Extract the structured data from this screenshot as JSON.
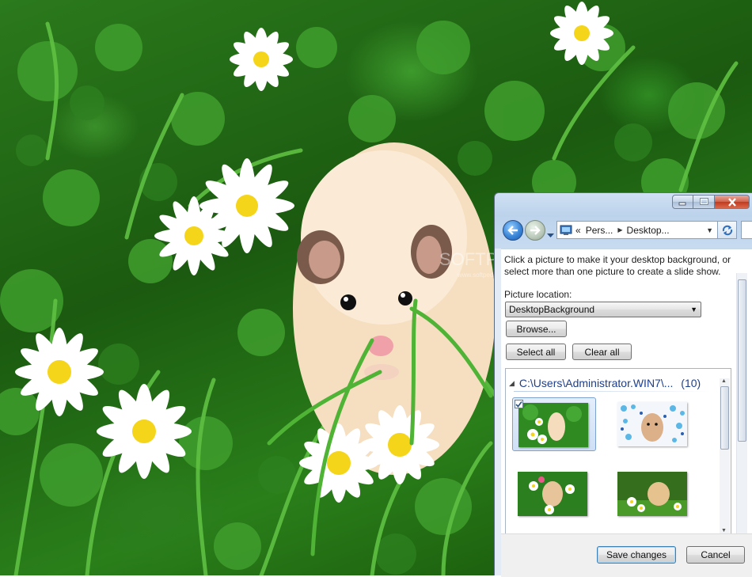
{
  "wallpaper": {
    "watermark": "SOFTPEDIA",
    "watermark_sub": "www.softpedia.com"
  },
  "window": {
    "caption": {
      "minimize_icon": "minimize-icon",
      "maximize_icon": "maximize-icon",
      "close_icon": "close-icon"
    },
    "nav": {
      "back_icon": "arrow-left-icon",
      "forward_icon": "arrow-right-icon",
      "breadcrumb_prefix": "«",
      "breadcrumbs": [
        "Pers...",
        "Desktop..."
      ],
      "refresh_icon": "refresh-icon"
    },
    "intro_text": "Click a picture to make it your desktop background, or select more than one picture to create a slide show.",
    "picture_location": {
      "label": "Picture location:",
      "value": "DesktopBackground"
    },
    "buttons": {
      "browse": "Browse...",
      "select_all": "Select all",
      "clear_all": "Clear all",
      "save": "Save changes",
      "cancel": "Cancel"
    },
    "gallery": {
      "group_path": "C:\\Users\\Administrator.WIN7\\...",
      "group_count": "(10)",
      "thumbnails": [
        {
          "name": "hamster-grass-daisies",
          "selected": true
        },
        {
          "name": "hamster-blue-dots",
          "selected": false
        },
        {
          "name": "hamster-between-flowers",
          "selected": false
        },
        {
          "name": "hamster-in-meadow",
          "selected": false
        }
      ]
    }
  },
  "colors": {
    "link_blue": "#1e3f8a",
    "close_red": "#c23a1f",
    "grass_green": "#2b7a1c"
  }
}
